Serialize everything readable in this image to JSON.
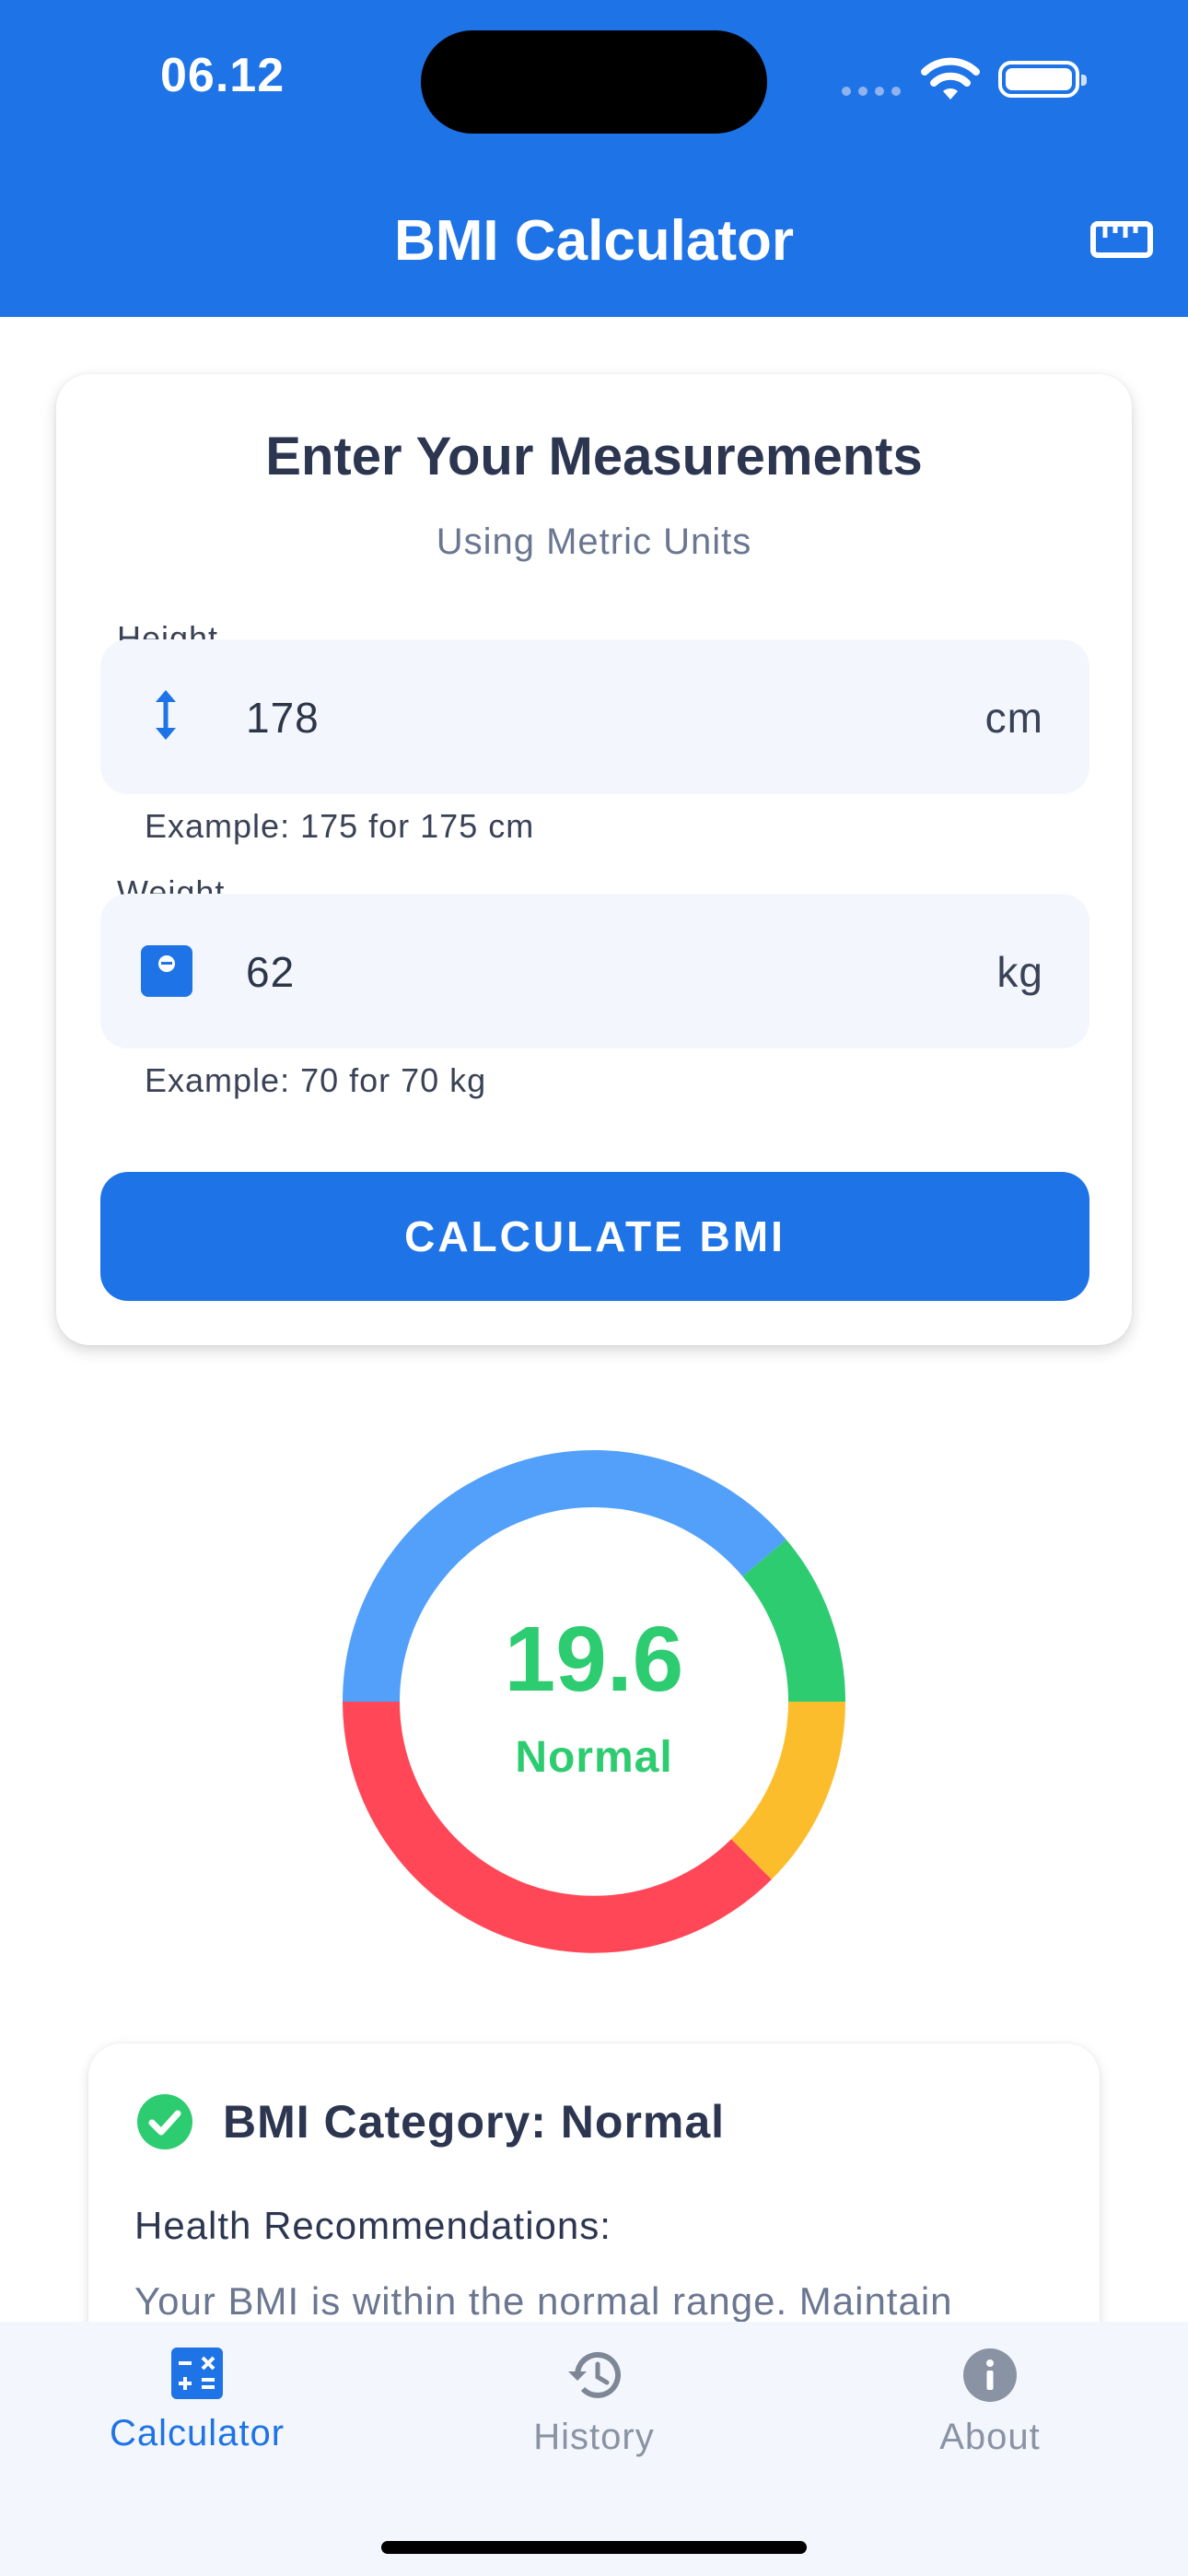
{
  "status_bar": {
    "time": "06.12",
    "icons": [
      "signal-icon",
      "wifi-icon",
      "battery-icon"
    ]
  },
  "app_bar": {
    "title": "BMI Calculator",
    "action_icon": "ruler-icon"
  },
  "form": {
    "title": "Enter Your Measurements",
    "subtitle": "Using Metric Units",
    "height": {
      "label": "Height",
      "value": "178",
      "unit": "cm",
      "hint": "Example: 175 for 175 cm",
      "icon": "vertical-arrows-icon"
    },
    "weight": {
      "label": "Weight",
      "value": "62",
      "unit": "kg",
      "hint": "Example: 70 for 70 kg",
      "icon": "scale-icon"
    },
    "button_label": "CALCULATE BMI"
  },
  "result": {
    "bmi_value": "19.6",
    "category_label": "Normal",
    "gauge_segments": [
      {
        "color": "#52a0fa",
        "label": "underweight"
      },
      {
        "color": "#2ecc71",
        "label": "normal"
      },
      {
        "color": "#fcbd2c",
        "label": "overweight"
      },
      {
        "color": "#ff4757",
        "label": "obese"
      }
    ],
    "category_title": "BMI Category: Normal",
    "recommendations_heading": "Health Recommendations:",
    "recommendations_text": "Your BMI is within the normal range. Maintain"
  },
  "colors": {
    "primary": "#1e73e6",
    "normal": "#2ecc71"
  },
  "nav": {
    "items": [
      {
        "label": "Calculator",
        "icon": "calculator-icon",
        "active": true
      },
      {
        "label": "History",
        "icon": "history-icon",
        "active": false
      },
      {
        "label": "About",
        "icon": "info-icon",
        "active": false
      }
    ]
  }
}
